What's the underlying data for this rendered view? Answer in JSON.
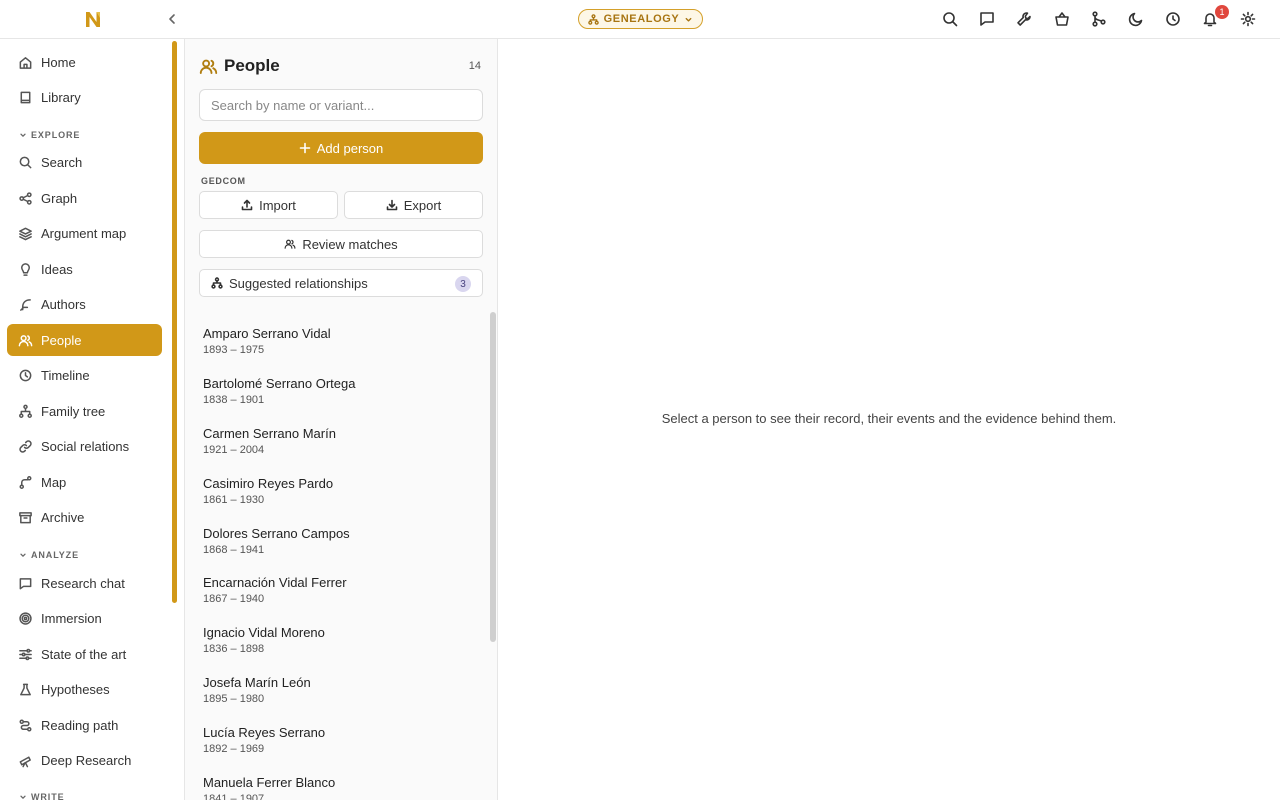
{
  "topbar": {
    "mode_label": "GENEALOGY",
    "notification_count": "1",
    "icons": [
      "search-icon",
      "chat-icon",
      "wrench-icon",
      "basket-icon",
      "merge-icon",
      "moon-icon",
      "clock-icon",
      "bell-icon",
      "gear-icon"
    ]
  },
  "sidebar": {
    "top_items": [
      {
        "label": "Home",
        "icon": "home-icon"
      },
      {
        "label": "Library",
        "icon": "book-icon"
      }
    ],
    "explore_label": "EXPLORE",
    "explore_items": [
      {
        "label": "Search",
        "icon": "search-icon"
      },
      {
        "label": "Graph",
        "icon": "share-icon"
      },
      {
        "label": "Argument map",
        "icon": "layers-icon"
      },
      {
        "label": "Ideas",
        "icon": "lightbulb-icon"
      },
      {
        "label": "Authors",
        "icon": "feather-icon"
      },
      {
        "label": "People",
        "icon": "users-icon",
        "active": true
      },
      {
        "label": "Timeline",
        "icon": "clock-icon"
      },
      {
        "label": "Family tree",
        "icon": "tree-icon"
      },
      {
        "label": "Social relations",
        "icon": "link-icon"
      },
      {
        "label": "Map",
        "icon": "route-icon"
      },
      {
        "label": "Archive",
        "icon": "archive-icon"
      }
    ],
    "analyze_label": "ANALYZE",
    "analyze_items": [
      {
        "label": "Research chat",
        "icon": "chat-icon"
      },
      {
        "label": "Immersion",
        "icon": "target-icon"
      },
      {
        "label": "State of the art",
        "icon": "sliders-icon"
      },
      {
        "label": "Hypotheses",
        "icon": "flask-icon"
      },
      {
        "label": "Reading path",
        "icon": "path-icon"
      },
      {
        "label": "Deep Research",
        "icon": "telescope-icon"
      }
    ],
    "write_label": "WRITE"
  },
  "people_panel": {
    "title": "People",
    "count": "14",
    "search_placeholder": "Search by name or variant...",
    "add_label": "Add person",
    "gedcom_label": "GEDCOM",
    "import_label": "Import",
    "export_label": "Export",
    "review_label": "Review matches",
    "suggested_label": "Suggested relationships",
    "suggested_count": "3",
    "people": [
      {
        "name": "Amparo Serrano Vidal",
        "dates": "1893 – 1975"
      },
      {
        "name": "Bartolomé Serrano Ortega",
        "dates": "1838 – 1901"
      },
      {
        "name": "Carmen Serrano Marín",
        "dates": "1921 – 2004"
      },
      {
        "name": "Casimiro Reyes Pardo",
        "dates": "1861 – 1930"
      },
      {
        "name": "Dolores Serrano Campos",
        "dates": "1868 – 1941"
      },
      {
        "name": "Encarnación Vidal Ferrer",
        "dates": "1867 – 1940"
      },
      {
        "name": "Ignacio Vidal Moreno",
        "dates": "1836 – 1898"
      },
      {
        "name": "Josefa Marín León",
        "dates": "1895 – 1980"
      },
      {
        "name": "Lucía Reyes Serrano",
        "dates": "1892 – 1969"
      },
      {
        "name": "Manuela Ferrer Blanco",
        "dates": "1841 – 1907"
      }
    ]
  },
  "main": {
    "empty_message": "Select a person to see their record, their events and the evidence behind them."
  },
  "colors": {
    "accent": "#d19818",
    "badge_red": "#e0473d",
    "suggest_badge": "#d9d6ef"
  }
}
